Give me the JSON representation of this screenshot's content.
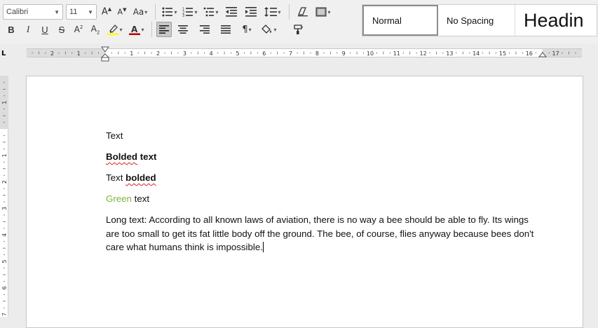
{
  "toolbar": {
    "font_name": "Calibri",
    "font_size": "11",
    "styles": [
      {
        "label": "Normal",
        "selected": true
      },
      {
        "label": "No Spacing",
        "selected": false
      },
      {
        "label": "Headin",
        "selected": false
      }
    ]
  },
  "ruler": {
    "horizontal_labels": [
      "2",
      "1",
      "1",
      "2",
      "3",
      "4",
      "5",
      "6",
      "7",
      "8",
      "9",
      "10",
      "11",
      "12",
      "13",
      "14",
      "15",
      "16",
      "17"
    ],
    "vertical_labels": [
      "1",
      "1",
      "2",
      "3",
      "4",
      "5",
      "6",
      "7"
    ],
    "corner_symbol": "L"
  },
  "document": {
    "line1": "Text",
    "line2_bold1": "Bolded",
    "line2_bold2": " text",
    "line3_plain": "Text ",
    "line3_bold": "bolded",
    "line4_green": "Green",
    "line4_plain": " text",
    "long_text": "Long text: According to all known laws of aviation, there is no way a bee should be able to fly. Its wings are too small to get its fat little body off the ground. The bee, of course, flies anyway because bees don't care what humans think is impossible."
  },
  "colors": {
    "green_text": "#7cb342",
    "highlight": "#ffff00",
    "font_color": "#c00000",
    "spell_underline": "#d92020"
  }
}
